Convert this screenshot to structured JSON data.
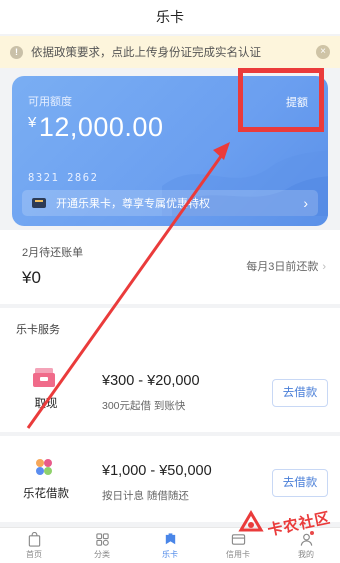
{
  "header": {
    "title": "乐卡"
  },
  "notice": {
    "text": "依据政策要求，点此上传身份证完成实名认证"
  },
  "card": {
    "label": "可用额度",
    "currency": "¥",
    "amount": "12,000.00",
    "withdraw_label": "提额",
    "card_number": "8321 2862",
    "promo_text": "开通乐果卡，尊享专属优惠特权"
  },
  "bill": {
    "title": "2月待还账单",
    "amount": "¥0",
    "due_text": "每月3日前还款"
  },
  "services": {
    "title": "乐卡服务",
    "items": [
      {
        "name": "取现",
        "range": "¥300 - ¥20,000",
        "sub": "300元起借  到账快",
        "button": "去借款",
        "icon": "cash-envelope-icon",
        "color": "#f06b8a"
      },
      {
        "name": "乐花借款",
        "range": "¥1,000 - ¥50,000",
        "sub": "按日计息  随借随还",
        "button": "去借款",
        "icon": "flower-icon",
        "color": "#5b8def"
      }
    ]
  },
  "tabbar": {
    "items": [
      {
        "label": "首页",
        "icon": "bag-icon",
        "active": false
      },
      {
        "label": "分类",
        "icon": "grid-icon",
        "active": false
      },
      {
        "label": "乐卡",
        "icon": "card-icon",
        "active": true
      },
      {
        "label": "信用卡",
        "icon": "credit-card-icon",
        "active": false
      },
      {
        "label": "我的",
        "icon": "user-icon",
        "active": false
      }
    ]
  },
  "watermark": {
    "text": "卡农社区"
  },
  "colors": {
    "accent": "#4a86e8",
    "annotation": "#ea3b3b",
    "notice_bg": "#fdf5dc"
  }
}
